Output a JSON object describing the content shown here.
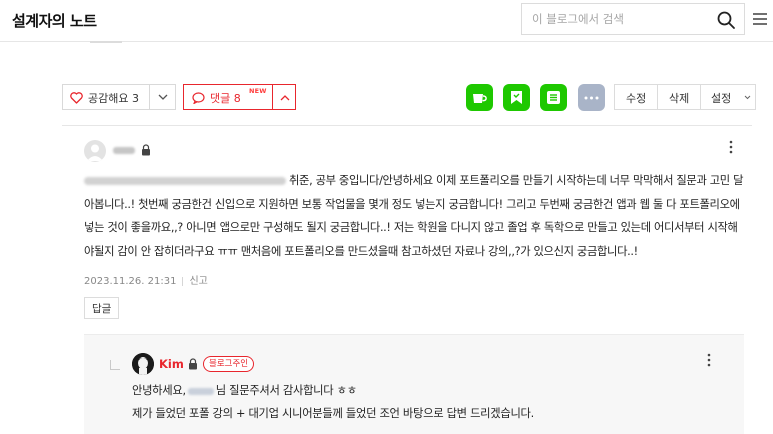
{
  "header": {
    "blog_title": "설계자의 노트",
    "search_placeholder": "이 블로그에서 검색"
  },
  "actions": {
    "like_label": "공감해요 3",
    "comment_label": "댓글 8",
    "new_badge": "NEW",
    "edit_label": "수정",
    "delete_label": "삭제",
    "settings_label": "설정"
  },
  "share_buttons": [
    {
      "icon": "cup-icon",
      "color": "#1ec800"
    },
    {
      "icon": "bookmark-icon",
      "color": "#1ec800"
    },
    {
      "icon": "list-icon",
      "color": "#1ec800"
    },
    {
      "icon": "more-icon",
      "color": "#a9b4c8"
    }
  ],
  "comment": {
    "body_after_name": "취준, 공부 중입니다/안녕하세요 이제 포트폴리오를 만들기 시작하는데 너무 막막해서 질문과 고민 달아봅니다..! 첫번째 궁금한건 신입으로 지원하면 보통 작업물을 몇개 정도 넣는지 궁금합니다! 그리고 두번째 궁금한건 앱과 웹 둘 다 포트폴리오에 넣는 것이 좋을까요,,? 아니면 앱으로만 구성해도 될지 궁금합니다..! 저는 학원을 다니지 않고 졸업 후 독학으로 만들고 있는데 어디서부터 시작해야될지 감이 안 잡히더라구요 ㅠㅠ 맨처음에 포트폴리오를 만드셨을때 참고하셨던 자료나 강의,,?가 있으신지 궁금합니다..!",
    "timestamp": "2023.11.26. 21:31",
    "report_label": "신고",
    "reply_label": "답글"
  },
  "reply": {
    "author": "Kim",
    "badge": "블로그주인",
    "line1_before": "안녕하세요,",
    "line1_after": "님 질문주셔서 감사합니다 ㅎㅎ",
    "line2": "제가 들었던 포폴 강의 + 대기업 시니어분들께 들었던 조언 바탕으로 답변 드리겠습니다."
  },
  "colors": {
    "accent_red": "#e8262d",
    "naver_green": "#1ec800"
  }
}
